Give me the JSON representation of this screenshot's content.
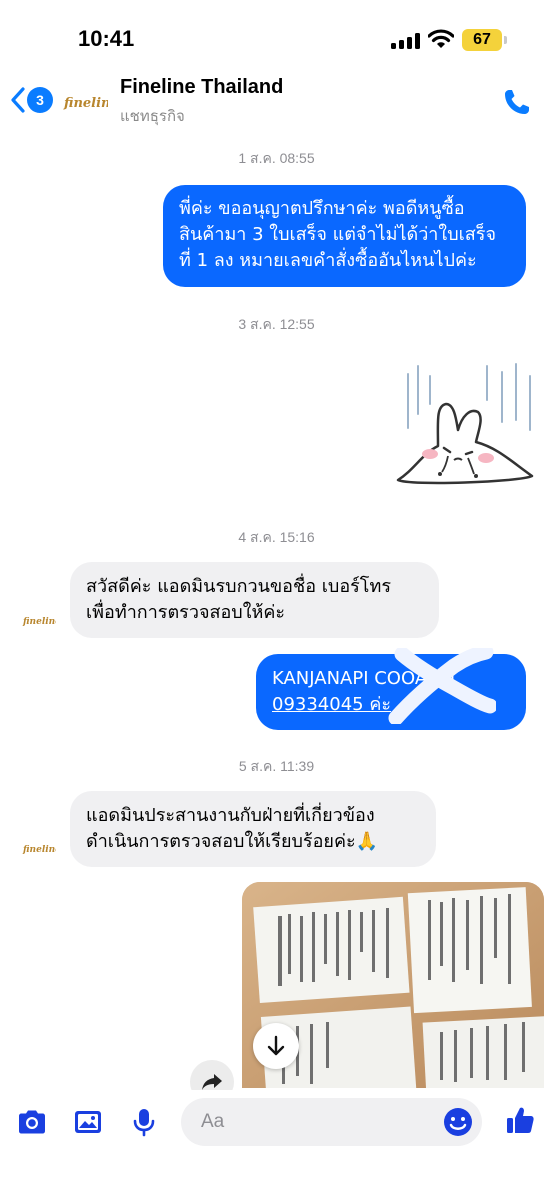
{
  "status_bar": {
    "time": "10:41",
    "battery": "67"
  },
  "header": {
    "back_count": "3",
    "contact_name": "Fineline Thailand",
    "contact_subtitle": "แชทธุรกิจ",
    "logo_text": "fineline"
  },
  "messages": [
    {
      "timestamp": "1 ส.ค. 08:55"
    },
    {
      "direction": "outgoing",
      "lines": [
        "พี่ค่ะ ขออนุญาตปรึกษาค่ะ พอดีหนูซื้อ",
        "สินค้ามา 3 ใบเสร็จ แต่จำไม่ได้ว่าใบเสร็จ",
        "ที่ 1 ลง หมายเลขคำสั่งซื้ออันไหนไปค่ะ"
      ]
    },
    {
      "timestamp": "3 ส.ค. 12:55"
    },
    {
      "direction": "outgoing",
      "type": "sticker",
      "sticker": "crying-bunny-sticker"
    },
    {
      "timestamp": "4 ส.ค. 15:16"
    },
    {
      "direction": "incoming",
      "lines": [
        "สวัสดีค่ะ แอดมินรบกวนขอชื่อ เบอร์โทร",
        "เพื่อทำการตรวจสอบให้ค่ะ"
      ]
    },
    {
      "direction": "outgoing",
      "lines": [
        "KANJANAPI    COOALAI",
        "09334045      ค่ะ"
      ]
    },
    {
      "timestamp": "5 ส.ค. 11:39"
    },
    {
      "direction": "incoming",
      "lines": [
        "แอดมินประสานงานกับฝ่ายที่เกี่ยวข้อง",
        "ดำเนินการตรวจสอบให้เรียบร้อยค่ะ🙏"
      ]
    },
    {
      "direction": "outgoing",
      "type": "photo",
      "photo": "receipts-photo"
    }
  ],
  "composer": {
    "placeholder": "Aa"
  },
  "colors": {
    "accent": "#0a7cff",
    "outgoing_bubble": "#0a68ff",
    "incoming_bubble": "#f0f0f2",
    "icon": "#1a3fe0"
  }
}
